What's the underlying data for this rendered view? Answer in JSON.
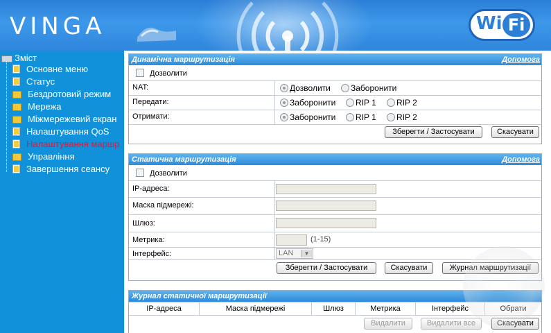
{
  "header": {
    "brand": "VINGA",
    "wifi_left": "Wi",
    "wifi_right": "Fi"
  },
  "sidebar": {
    "root_label": "Зміст",
    "items": [
      {
        "label": "Основне меню",
        "icon": "page-icon"
      },
      {
        "label": "Статус",
        "icon": "page-icon"
      },
      {
        "label": "Бездротовий режим",
        "icon": "folder-icon"
      },
      {
        "label": "Мережа",
        "icon": "folder-icon"
      },
      {
        "label": "Міжмережевий екран",
        "icon": "folder-icon"
      },
      {
        "label": "Налаштування QoS",
        "icon": "page-icon"
      },
      {
        "label": "Налаштування маршр",
        "icon": "page-icon",
        "active": true
      },
      {
        "label": "Управління",
        "icon": "folder-icon"
      },
      {
        "label": "Завершення сеансу",
        "icon": "page-icon"
      }
    ]
  },
  "dynamic": {
    "title": "Динамічна маршрутизація",
    "help": "Допомога",
    "enable_label": "Дозволити",
    "nat_label": "NAT:",
    "nat_allow": "Дозволити",
    "nat_deny": "Заборонити",
    "send_label": "Передати:",
    "send_deny": "Заборонити",
    "send_rip1": "RIP 1",
    "send_rip2": "RIP 2",
    "recv_label": "Отримати:",
    "recv_deny": "Заборонити",
    "recv_rip1": "RIP 1",
    "recv_rip2": "RIP 2",
    "save": "Зберегти / Застосувати",
    "cancel": "Скасувати"
  },
  "static": {
    "title": "Статична маршрутизація",
    "help": "Допомога",
    "enable_label": "Дозволити",
    "ip_label": "IP-адреса:",
    "mask_label": "Маска підмережі:",
    "gateway_label": "Шлюз:",
    "metric_label": "Метрика:",
    "metric_hint": "(1-15)",
    "iface_label": "Інтерфейс:",
    "iface_value": "LAN",
    "save": "Зберегти / Застосувати",
    "cancel": "Скасувати",
    "log": "Журнал маршрутизації"
  },
  "journal": {
    "title": "Журнал статичної маршрутизації",
    "columns": [
      "IP-адреса",
      "Маска підмережі",
      "Шлюз",
      "Метрика",
      "Інтерфейс",
      "Обрати"
    ],
    "delete": "Видалити",
    "delete_all": "Видалити все",
    "cancel": "Скасувати"
  }
}
